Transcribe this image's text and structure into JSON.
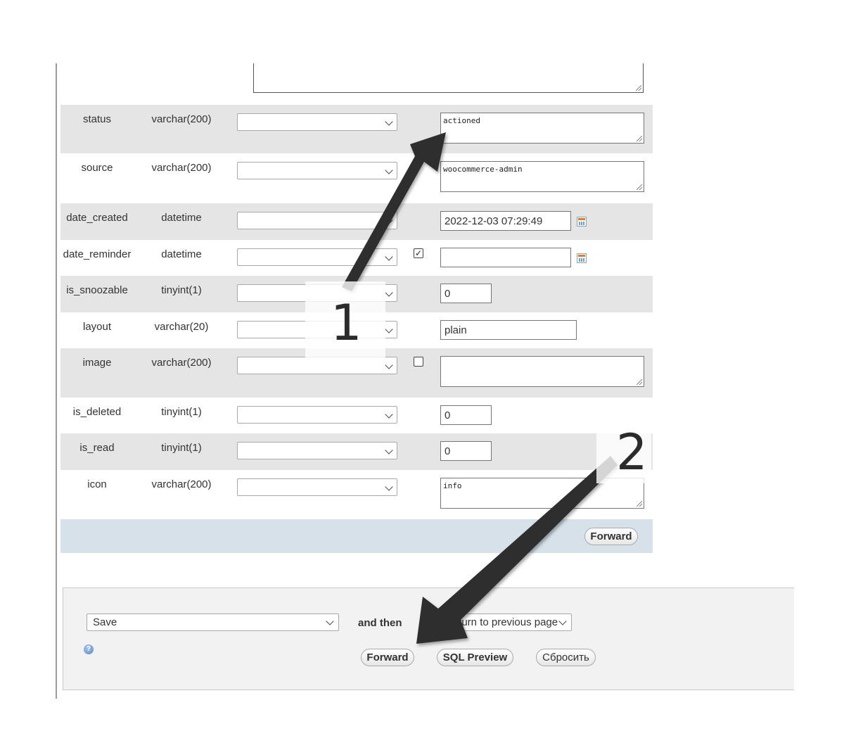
{
  "fields": [
    {
      "name": "status",
      "type": "varchar(200)",
      "value": "actioned",
      "kind": "textarea",
      "null_checkbox": null
    },
    {
      "name": "source",
      "type": "varchar(200)",
      "value": "woocommerce-admin",
      "kind": "textarea",
      "null_checkbox": null
    },
    {
      "name": "date_created",
      "type": "datetime",
      "value": "2022-12-03 07:29:49",
      "kind": "datetime",
      "null_checkbox": null
    },
    {
      "name": "date_reminder",
      "type": "datetime",
      "value": "",
      "kind": "datetime",
      "null_checkbox": "checked"
    },
    {
      "name": "is_snoozable",
      "type": "tinyint(1)",
      "value": "0",
      "kind": "small",
      "null_checkbox": null
    },
    {
      "name": "layout",
      "type": "varchar(20)",
      "value": "plain",
      "kind": "medium",
      "null_checkbox": null
    },
    {
      "name": "image",
      "type": "varchar(200)",
      "value": "",
      "kind": "textarea",
      "null_checkbox": "unchecked"
    },
    {
      "name": "is_deleted",
      "type": "tinyint(1)",
      "value": "0",
      "kind": "small",
      "null_checkbox": null
    },
    {
      "name": "is_read",
      "type": "tinyint(1)",
      "value": "0",
      "kind": "small",
      "null_checkbox": null
    },
    {
      "name": "icon",
      "type": "varchar(200)",
      "value": "info",
      "kind": "textarea",
      "null_checkbox": null
    }
  ],
  "row_forward_label": "Forward",
  "bottom": {
    "action_select": "Save",
    "and_then_label": "and then",
    "after_select": "Return to previous page",
    "forward_label": "Forward",
    "sql_preview_label": "SQL Preview",
    "reset_label": "Сбросить",
    "help_icon": "help-icon"
  },
  "annotations": {
    "arrow1_label": "1",
    "arrow2_label": "2"
  },
  "colors": {
    "row_shade": "#e5e5e5",
    "forward_band": "#d6e1ea",
    "panel": "#f2f2f2",
    "arrow": "#2e2e2e"
  }
}
